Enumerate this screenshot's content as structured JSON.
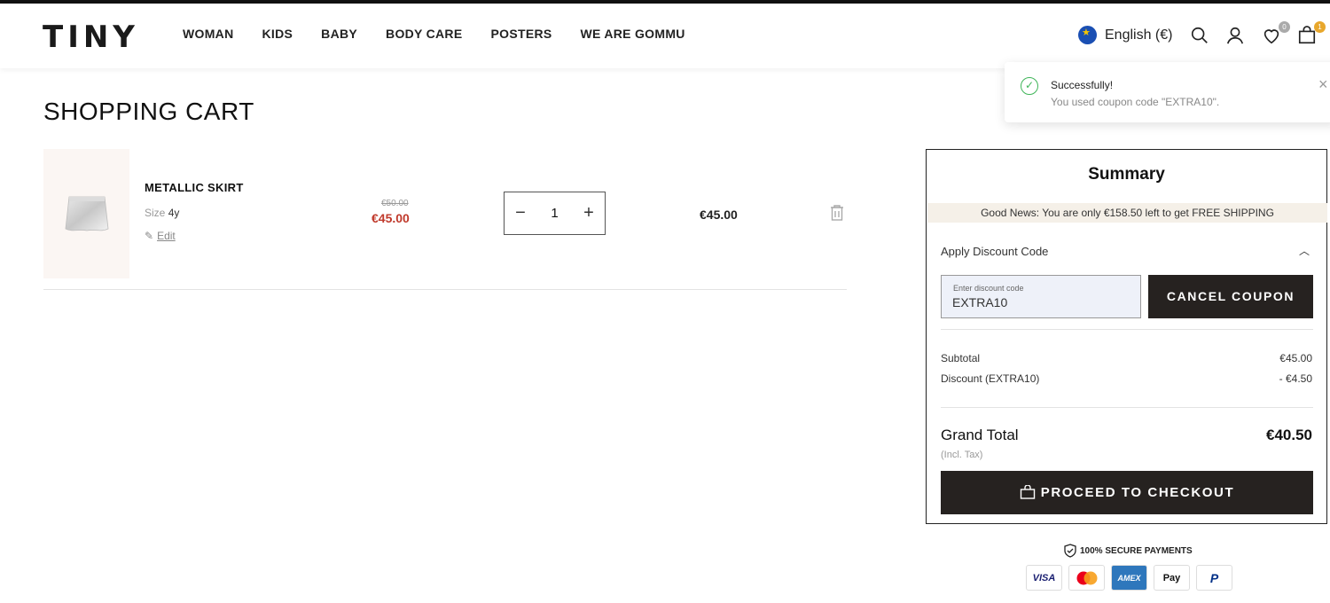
{
  "header": {
    "logo": "TINY",
    "nav": [
      "WOMAN",
      "KIDS",
      "BABY",
      "BODY CARE",
      "POSTERS",
      "WE ARE GOMMU"
    ],
    "language": "English (€)",
    "wishlist_count": "0",
    "cart_count": "1"
  },
  "toast": {
    "title": "Successfully!",
    "message": "You used coupon code \"EXTRA10\"."
  },
  "page": {
    "title": "SHOPPING CART"
  },
  "cart_item": {
    "name": "METALLIC SKIRT",
    "size_label": "Size",
    "size_value": "4y",
    "edit_label": "Edit",
    "old_price": "€50.00",
    "price": "€45.00",
    "quantity": "1",
    "row_total": "€45.00"
  },
  "summary": {
    "title": "Summary",
    "good_news": "Good News: You are only €158.50 left to get FREE SHIPPING",
    "discount_heading": "Apply Discount Code",
    "discount_field_label": "Enter discount code",
    "discount_code": "EXTRA10",
    "cancel_coupon": "CANCEL COUPON",
    "subtotal_label": "Subtotal",
    "subtotal_value": "€45.00",
    "discount_label": "Discount (EXTRA10)",
    "discount_value": "- €4.50",
    "grand_total_label": "Grand Total",
    "grand_total_value": "€40.50",
    "tax_note": "(Incl. Tax)",
    "checkout": "PROCEED TO CHECKOUT"
  },
  "payments": {
    "secure_label": "100% SECURE PAYMENTS",
    "methods": [
      "VISA",
      "Mastercard",
      "AMEX",
      "Apple Pay",
      "PayPal"
    ]
  },
  "colors": {
    "sale_price": "#c0392b",
    "button_dark": "#262220",
    "news_bg": "#f5f0e8",
    "success": "#3fb559"
  }
}
